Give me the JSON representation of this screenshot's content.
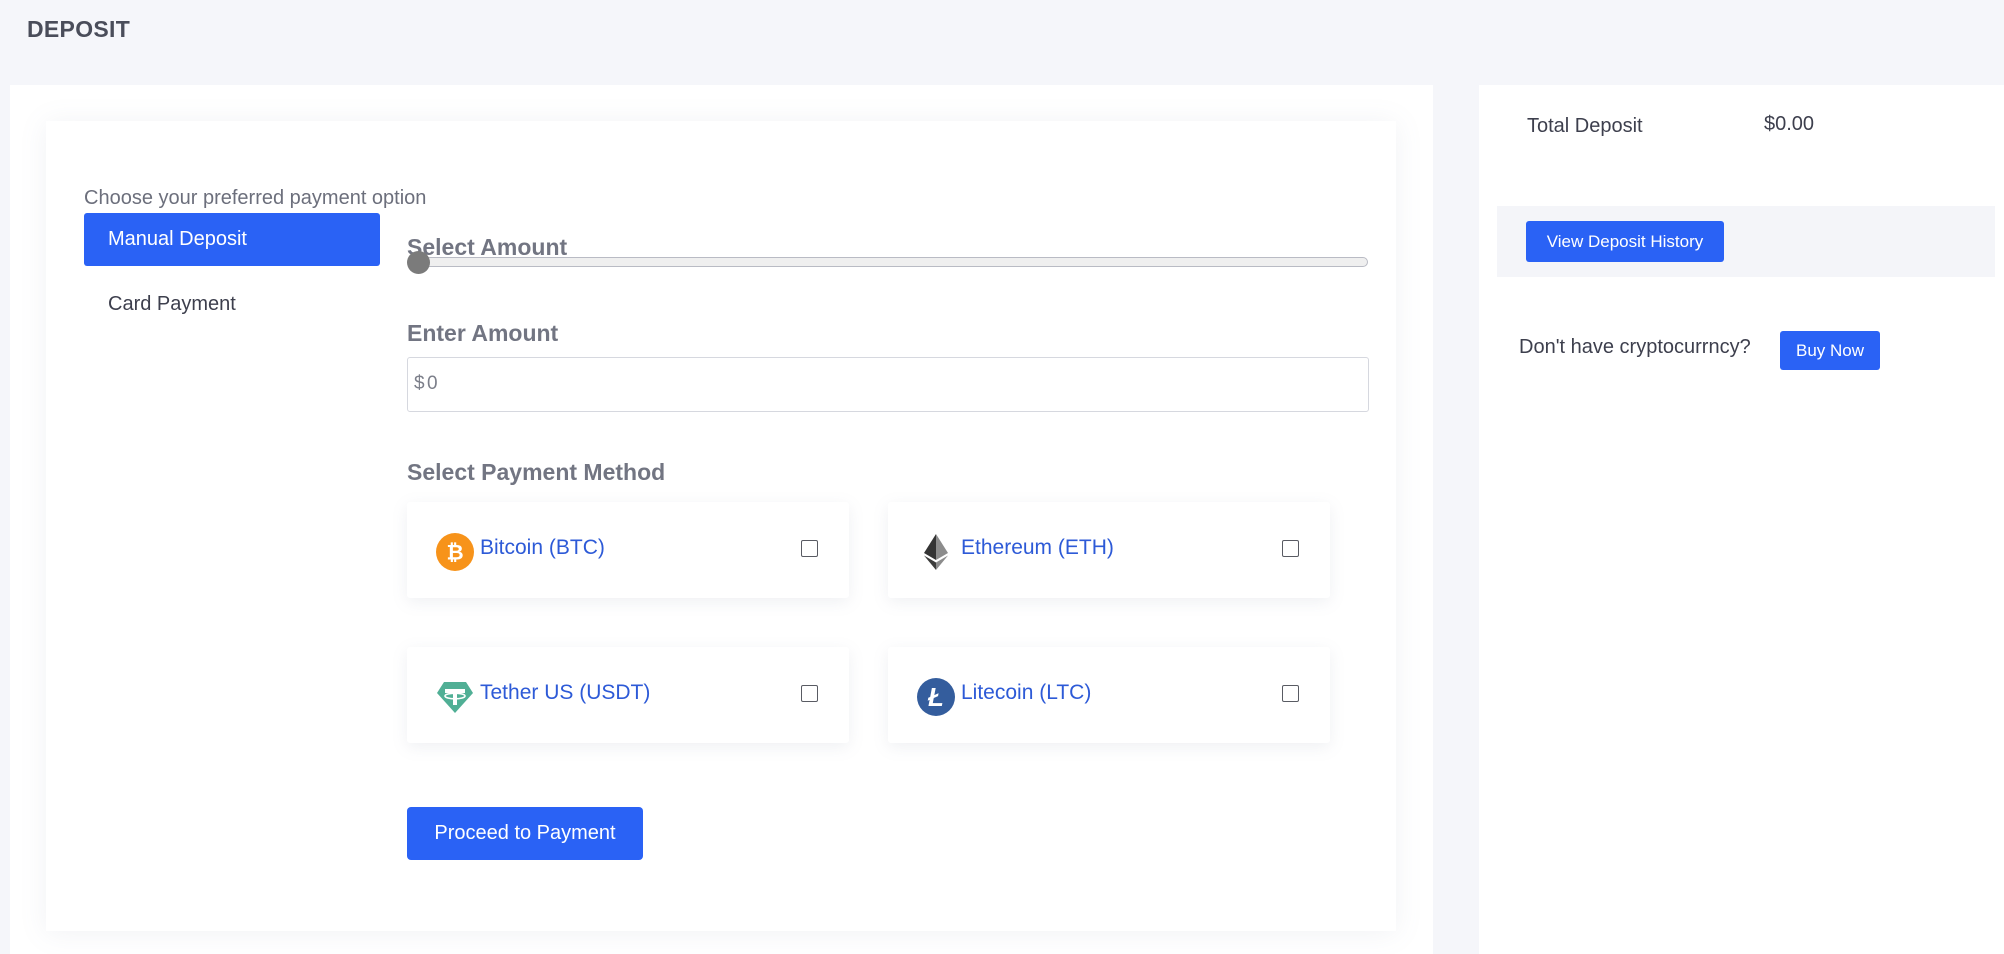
{
  "page": {
    "title": "DEPOSIT"
  },
  "deposit_form": {
    "intro": "Choose your preferred payment option",
    "tabs": [
      {
        "label": "Manual Deposit",
        "active": true
      },
      {
        "label": "Card Payment",
        "active": false
      }
    ],
    "select_amount_label": "Select Amount",
    "slider_value": 0,
    "enter_amount_label": "Enter Amount",
    "currency_prefix": "$",
    "amount_placeholder": "0",
    "payment_method_label": "Select Payment Method",
    "methods": [
      {
        "name": "Bitcoin (BTC)",
        "icon": "bitcoin-icon",
        "checked": false
      },
      {
        "name": "Ethereum (ETH)",
        "icon": "ethereum-icon",
        "checked": false
      },
      {
        "name": "Tether US (USDT)",
        "icon": "tether-icon",
        "checked": false
      },
      {
        "name": "Litecoin (LTC)",
        "icon": "litecoin-icon",
        "checked": false
      }
    ],
    "proceed_label": "Proceed to Payment"
  },
  "summary": {
    "total_label": "Total Deposit",
    "total_value": "$0.00",
    "history_button": "View Deposit History",
    "crypto_prompt": "Don't have cryptocurrncy?",
    "buy_button": "Buy Now"
  },
  "colors": {
    "accent": "#2a62f5",
    "link": "#2d5ad7",
    "bitcoin": "#f7931a",
    "tether": "#50af95",
    "litecoin": "#345d9d",
    "page_background": "#f5f6fa"
  }
}
